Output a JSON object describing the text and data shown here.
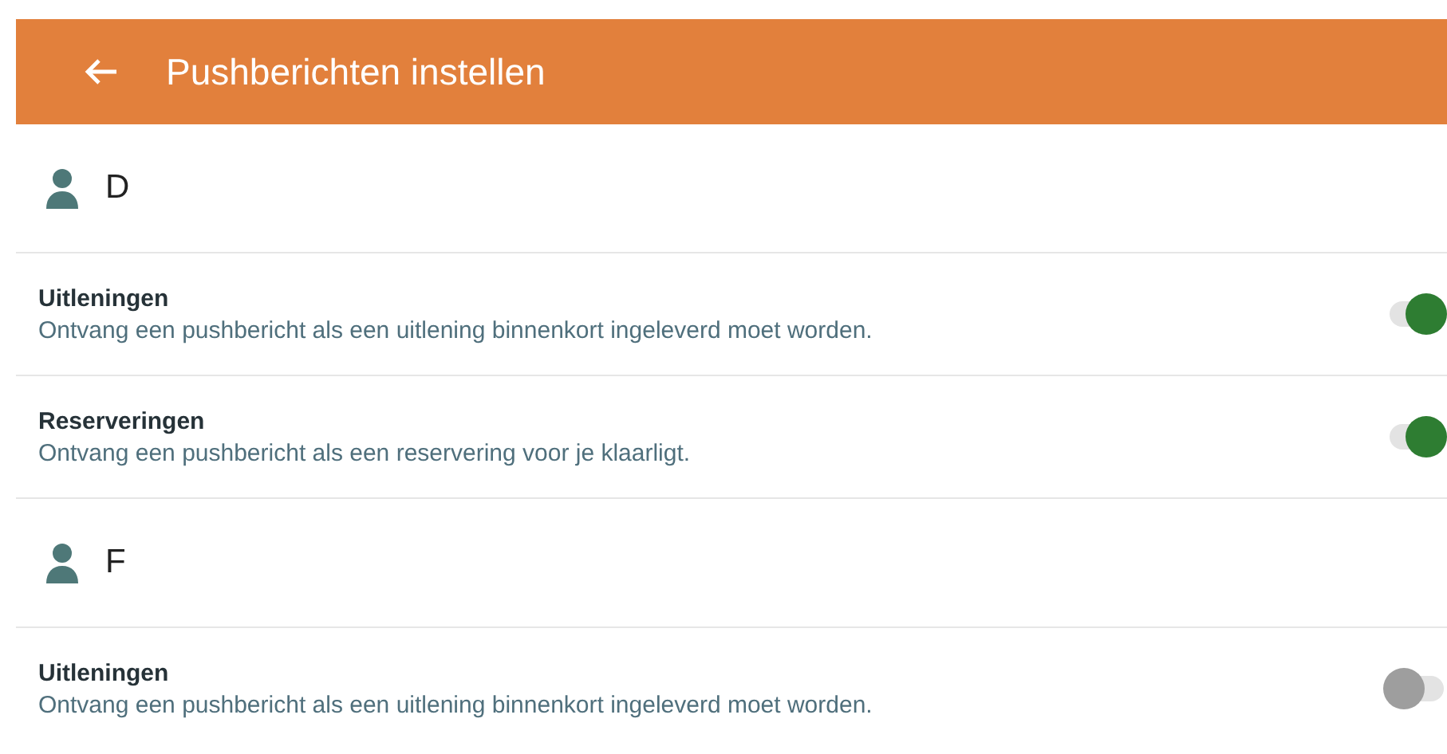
{
  "app_bar": {
    "title": "Pushberichten instellen"
  },
  "accounts": [
    {
      "name": "D",
      "settings": [
        {
          "title": "Uitleningen",
          "description": "Ontvang een pushbericht als een uitlening binnenkort ingeleverd moet worden.",
          "on": true
        },
        {
          "title": "Reserveringen",
          "description": "Ontvang een pushbericht als een reservering voor je klaarligt.",
          "on": true
        }
      ]
    },
    {
      "name": "F",
      "settings": [
        {
          "title": "Uitleningen",
          "description": "Ontvang een pushbericht als een uitlening binnenkort ingeleverd moet worden.",
          "on": false
        }
      ]
    }
  ]
}
